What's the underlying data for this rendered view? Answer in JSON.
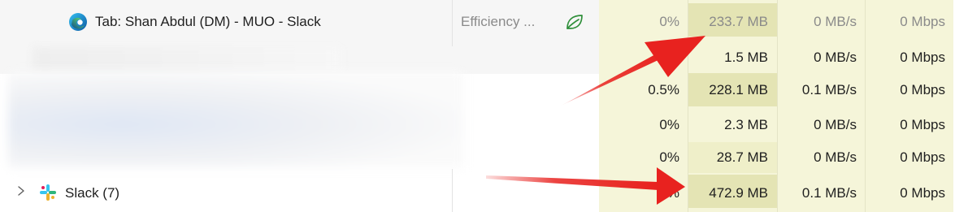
{
  "rows": [
    {
      "name": "Tab: Shan Abdul (DM) - MUO - Slack",
      "status": "Efficiency ...",
      "cpu": "0%",
      "memory": "233.7 MB",
      "disk": "0 MB/s",
      "network": "0 Mbps"
    },
    {
      "name": "",
      "status": "",
      "cpu": "0%",
      "memory": "1.5 MB",
      "disk": "0 MB/s",
      "network": "0 Mbps"
    },
    {
      "name": "",
      "status": "",
      "cpu": "0.5%",
      "memory": "228.1 MB",
      "disk": "0.1 MB/s",
      "network": "0 Mbps"
    },
    {
      "name": "",
      "status": "",
      "cpu": "0%",
      "memory": "2.3 MB",
      "disk": "0 MB/s",
      "network": "0 Mbps"
    },
    {
      "name": "",
      "status": "",
      "cpu": "0%",
      "memory": "28.7 MB",
      "disk": "0 MB/s",
      "network": "0 Mbps"
    },
    {
      "name": "Slack (7)",
      "status": "",
      "cpu": "0%",
      "memory": "472.9 MB",
      "disk": "0.1 MB/s",
      "network": "0 Mbps"
    }
  ],
  "icons": {
    "row0": "edge-icon",
    "row0_status": "efficiency-leaf-icon",
    "row5_expand": "chevron-right-icon",
    "row5": "slack-icon"
  },
  "colors": {
    "metric_bg": "#f5f5d9",
    "metric_highlight": "#e4e4b4",
    "arrow": "#e8221f",
    "efficiency_green": "#2f8f3a"
  }
}
